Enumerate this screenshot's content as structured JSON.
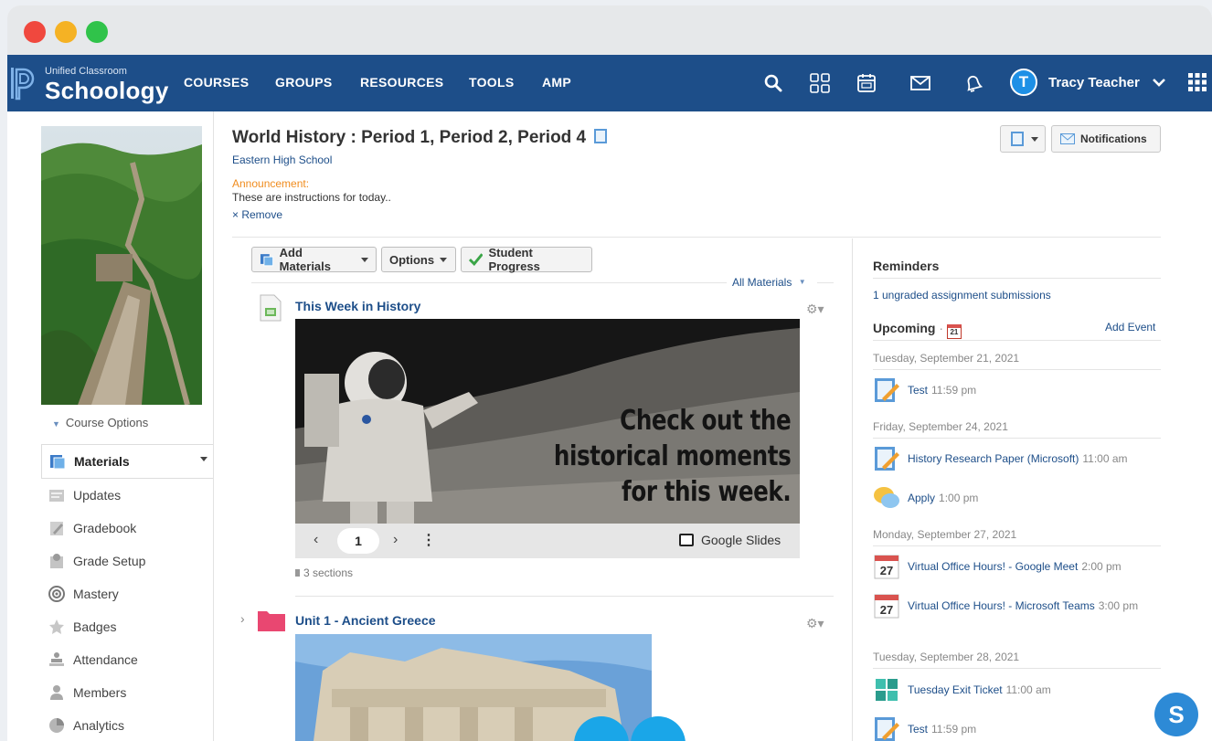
{
  "brand": {
    "small": "Unified Classroom",
    "big": "Schoology"
  },
  "nav": {
    "items": [
      "COURSES",
      "GROUPS",
      "RESOURCES",
      "TOOLS",
      "AMP"
    ]
  },
  "user": {
    "initial": "T",
    "name": "Tracy Teacher"
  },
  "course": {
    "title": "World History : Period 1, Period 2, Period 4",
    "school": "Eastern High School",
    "announcement_label": "Announcement:",
    "announcement_text": "These are instructions for today..",
    "remove_label": "× Remove",
    "notifications_label": "Notifications"
  },
  "sidebar": {
    "course_options": "Course Options",
    "items": [
      {
        "label": "Materials",
        "icon": "materials-icon"
      },
      {
        "label": "Updates",
        "icon": "updates-icon"
      },
      {
        "label": "Gradebook",
        "icon": "gradebook-icon"
      },
      {
        "label": "Grade Setup",
        "icon": "grade-setup-icon"
      },
      {
        "label": "Mastery",
        "icon": "mastery-icon"
      },
      {
        "label": "Badges",
        "icon": "badges-icon"
      },
      {
        "label": "Attendance",
        "icon": "attendance-icon"
      },
      {
        "label": "Members",
        "icon": "members-icon"
      },
      {
        "label": "Analytics",
        "icon": "analytics-icon"
      }
    ]
  },
  "toolbar": {
    "add_materials": "Add Materials",
    "options": "Options",
    "student_progress": "Student Progress",
    "all_materials": "All Materials"
  },
  "materials": {
    "item1": {
      "title": "This Week in History",
      "slide_text": [
        "Check out the",
        "historical moments",
        "for this week."
      ],
      "page": "1",
      "viewer_label": "Google Slides",
      "sections": "3 sections"
    },
    "item2": {
      "title": "Unit 1 - Ancient Greece"
    }
  },
  "reminders": {
    "title": "Reminders",
    "link": "1 ungraded assignment submissions"
  },
  "upcoming": {
    "title": "Upcoming",
    "calendar_day": "21",
    "add_event": "Add Event",
    "days": [
      {
        "date": "Tuesday, September 21, 2021"
      },
      {
        "date": "Friday, September 24, 2021"
      },
      {
        "date": "Monday, September 27, 2021"
      },
      {
        "date": "Tuesday, September 28, 2021"
      }
    ],
    "events": [
      {
        "title": "Test",
        "time": "11:59 pm",
        "icon": "assignment-icon"
      },
      {
        "title": "History Research Paper (Microsoft)",
        "time": "11:00 am",
        "icon": "assignment-icon"
      },
      {
        "title": "Apply",
        "time": "1:00 pm",
        "icon": "discussion-icon"
      },
      {
        "title": "Virtual Office Hours! - Google Meet",
        "time": "2:00 pm",
        "icon": "calendar-icon",
        "day": "27"
      },
      {
        "title": "Virtual Office Hours! - Microsoft Teams",
        "time": "3:00 pm",
        "icon": "calendar-icon",
        "day": "27"
      },
      {
        "title": "Tuesday Exit Ticket",
        "time": "11:00 am",
        "icon": "app-puzzle-icon"
      },
      {
        "title": "Test",
        "time": "11:59 pm",
        "icon": "assignment-icon"
      }
    ]
  },
  "fab": {
    "label": "S"
  },
  "colors": {
    "navbar": "#1d4e89",
    "link": "#1d4e89",
    "announcement": "#f08c1e",
    "avatar": "#1e90e6"
  }
}
